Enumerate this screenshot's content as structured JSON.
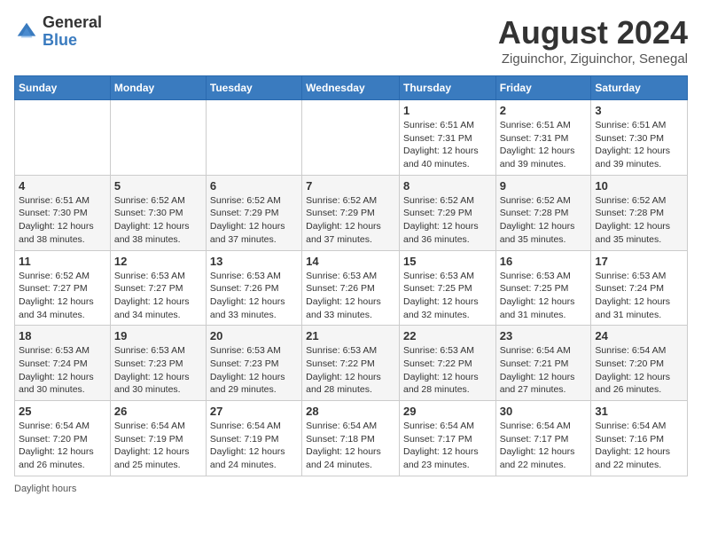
{
  "header": {
    "logo_general": "General",
    "logo_blue": "Blue",
    "month_year": "August 2024",
    "location": "Ziguinchor, Ziguinchor, Senegal"
  },
  "days_of_week": [
    "Sunday",
    "Monday",
    "Tuesday",
    "Wednesday",
    "Thursday",
    "Friday",
    "Saturday"
  ],
  "weeks": [
    [
      {
        "day": "",
        "sunrise": "",
        "sunset": "",
        "daylight": ""
      },
      {
        "day": "",
        "sunrise": "",
        "sunset": "",
        "daylight": ""
      },
      {
        "day": "",
        "sunrise": "",
        "sunset": "",
        "daylight": ""
      },
      {
        "day": "",
        "sunrise": "",
        "sunset": "",
        "daylight": ""
      },
      {
        "day": "1",
        "sunrise": "Sunrise: 6:51 AM",
        "sunset": "Sunset: 7:31 PM",
        "daylight": "Daylight: 12 hours and 40 minutes."
      },
      {
        "day": "2",
        "sunrise": "Sunrise: 6:51 AM",
        "sunset": "Sunset: 7:31 PM",
        "daylight": "Daylight: 12 hours and 39 minutes."
      },
      {
        "day": "3",
        "sunrise": "Sunrise: 6:51 AM",
        "sunset": "Sunset: 7:30 PM",
        "daylight": "Daylight: 12 hours and 39 minutes."
      }
    ],
    [
      {
        "day": "4",
        "sunrise": "Sunrise: 6:51 AM",
        "sunset": "Sunset: 7:30 PM",
        "daylight": "Daylight: 12 hours and 38 minutes."
      },
      {
        "day": "5",
        "sunrise": "Sunrise: 6:52 AM",
        "sunset": "Sunset: 7:30 PM",
        "daylight": "Daylight: 12 hours and 38 minutes."
      },
      {
        "day": "6",
        "sunrise": "Sunrise: 6:52 AM",
        "sunset": "Sunset: 7:29 PM",
        "daylight": "Daylight: 12 hours and 37 minutes."
      },
      {
        "day": "7",
        "sunrise": "Sunrise: 6:52 AM",
        "sunset": "Sunset: 7:29 PM",
        "daylight": "Daylight: 12 hours and 37 minutes."
      },
      {
        "day": "8",
        "sunrise": "Sunrise: 6:52 AM",
        "sunset": "Sunset: 7:29 PM",
        "daylight": "Daylight: 12 hours and 36 minutes."
      },
      {
        "day": "9",
        "sunrise": "Sunrise: 6:52 AM",
        "sunset": "Sunset: 7:28 PM",
        "daylight": "Daylight: 12 hours and 35 minutes."
      },
      {
        "day": "10",
        "sunrise": "Sunrise: 6:52 AM",
        "sunset": "Sunset: 7:28 PM",
        "daylight": "Daylight: 12 hours and 35 minutes."
      }
    ],
    [
      {
        "day": "11",
        "sunrise": "Sunrise: 6:52 AM",
        "sunset": "Sunset: 7:27 PM",
        "daylight": "Daylight: 12 hours and 34 minutes."
      },
      {
        "day": "12",
        "sunrise": "Sunrise: 6:53 AM",
        "sunset": "Sunset: 7:27 PM",
        "daylight": "Daylight: 12 hours and 34 minutes."
      },
      {
        "day": "13",
        "sunrise": "Sunrise: 6:53 AM",
        "sunset": "Sunset: 7:26 PM",
        "daylight": "Daylight: 12 hours and 33 minutes."
      },
      {
        "day": "14",
        "sunrise": "Sunrise: 6:53 AM",
        "sunset": "Sunset: 7:26 PM",
        "daylight": "Daylight: 12 hours and 33 minutes."
      },
      {
        "day": "15",
        "sunrise": "Sunrise: 6:53 AM",
        "sunset": "Sunset: 7:25 PM",
        "daylight": "Daylight: 12 hours and 32 minutes."
      },
      {
        "day": "16",
        "sunrise": "Sunrise: 6:53 AM",
        "sunset": "Sunset: 7:25 PM",
        "daylight": "Daylight: 12 hours and 31 minutes."
      },
      {
        "day": "17",
        "sunrise": "Sunrise: 6:53 AM",
        "sunset": "Sunset: 7:24 PM",
        "daylight": "Daylight: 12 hours and 31 minutes."
      }
    ],
    [
      {
        "day": "18",
        "sunrise": "Sunrise: 6:53 AM",
        "sunset": "Sunset: 7:24 PM",
        "daylight": "Daylight: 12 hours and 30 minutes."
      },
      {
        "day": "19",
        "sunrise": "Sunrise: 6:53 AM",
        "sunset": "Sunset: 7:23 PM",
        "daylight": "Daylight: 12 hours and 30 minutes."
      },
      {
        "day": "20",
        "sunrise": "Sunrise: 6:53 AM",
        "sunset": "Sunset: 7:23 PM",
        "daylight": "Daylight: 12 hours and 29 minutes."
      },
      {
        "day": "21",
        "sunrise": "Sunrise: 6:53 AM",
        "sunset": "Sunset: 7:22 PM",
        "daylight": "Daylight: 12 hours and 28 minutes."
      },
      {
        "day": "22",
        "sunrise": "Sunrise: 6:53 AM",
        "sunset": "Sunset: 7:22 PM",
        "daylight": "Daylight: 12 hours and 28 minutes."
      },
      {
        "day": "23",
        "sunrise": "Sunrise: 6:54 AM",
        "sunset": "Sunset: 7:21 PM",
        "daylight": "Daylight: 12 hours and 27 minutes."
      },
      {
        "day": "24",
        "sunrise": "Sunrise: 6:54 AM",
        "sunset": "Sunset: 7:20 PM",
        "daylight": "Daylight: 12 hours and 26 minutes."
      }
    ],
    [
      {
        "day": "25",
        "sunrise": "Sunrise: 6:54 AM",
        "sunset": "Sunset: 7:20 PM",
        "daylight": "Daylight: 12 hours and 26 minutes."
      },
      {
        "day": "26",
        "sunrise": "Sunrise: 6:54 AM",
        "sunset": "Sunset: 7:19 PM",
        "daylight": "Daylight: 12 hours and 25 minutes."
      },
      {
        "day": "27",
        "sunrise": "Sunrise: 6:54 AM",
        "sunset": "Sunset: 7:19 PM",
        "daylight": "Daylight: 12 hours and 24 minutes."
      },
      {
        "day": "28",
        "sunrise": "Sunrise: 6:54 AM",
        "sunset": "Sunset: 7:18 PM",
        "daylight": "Daylight: 12 hours and 24 minutes."
      },
      {
        "day": "29",
        "sunrise": "Sunrise: 6:54 AM",
        "sunset": "Sunset: 7:17 PM",
        "daylight": "Daylight: 12 hours and 23 minutes."
      },
      {
        "day": "30",
        "sunrise": "Sunrise: 6:54 AM",
        "sunset": "Sunset: 7:17 PM",
        "daylight": "Daylight: 12 hours and 22 minutes."
      },
      {
        "day": "31",
        "sunrise": "Sunrise: 6:54 AM",
        "sunset": "Sunset: 7:16 PM",
        "daylight": "Daylight: 12 hours and 22 minutes."
      }
    ]
  ],
  "footer": {
    "daylight_label": "Daylight hours"
  }
}
